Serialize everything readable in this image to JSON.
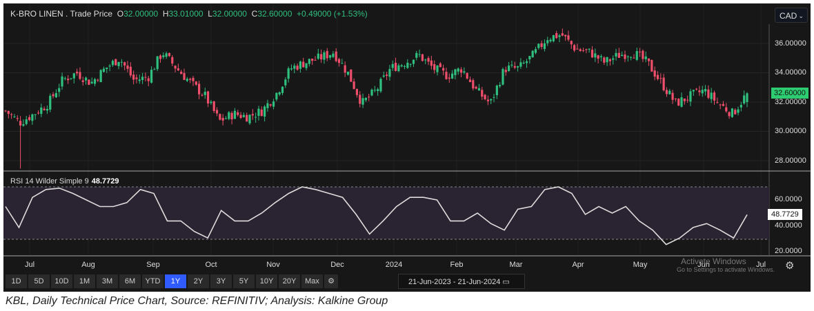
{
  "header": {
    "symbol": "K-BRO LINEN",
    "series": "Trade Price",
    "o_label": "O",
    "open": "32.00000",
    "h_label": "H",
    "high": "33.01000",
    "l_label": "L",
    "low": "32.00000",
    "c_label": "C",
    "close": "32.60000",
    "change": "+0.49000 (+1.53%)"
  },
  "currency": "CAD",
  "price_axis": [
    "36.00000",
    "34.00000",
    "32.00000",
    "30.00000",
    "28.00000"
  ],
  "last_price": "32.60000",
  "rsi": {
    "label": "RSI 14 Wilder Simple 9",
    "value": "48.7729",
    "axis": [
      "60.0000",
      "40.0000",
      "20.0000"
    ]
  },
  "months": [
    "Jul",
    "Aug",
    "Sep",
    "Oct",
    "Nov",
    "Dec",
    "2024",
    "Feb",
    "Mar",
    "Apr",
    "May",
    "Jun",
    "Jul"
  ],
  "ranges": [
    {
      "label": "1D"
    },
    {
      "label": "5D"
    },
    {
      "label": "10D"
    },
    {
      "label": "1M"
    },
    {
      "label": "3M"
    },
    {
      "label": "6M"
    },
    {
      "label": "YTD"
    },
    {
      "label": "1Y",
      "active": true
    },
    {
      "label": "2Y"
    },
    {
      "label": "3Y"
    },
    {
      "label": "5Y"
    },
    {
      "label": "10Y"
    },
    {
      "label": "20Y"
    },
    {
      "label": "Max"
    }
  ],
  "date_range": "21-Jun-2023  -  21-Jun-2024",
  "watermark": {
    "line1": "Activate Windows",
    "line2": "Go to Settings to activate Windows."
  },
  "caption": "KBL, Daily Technical Price Chart, Source: REFINITIV; Analysis: Kalkine Group",
  "colors": {
    "up": "#2fbf7f",
    "down": "#ef4f6b",
    "rsi_band": "#2a2432",
    "active": "#2f5bff"
  },
  "chart_data": {
    "type": "candlestick",
    "ylim": [
      27.5,
      37.2
    ],
    "closes": [
      31.4,
      30.6,
      31.2,
      31.9,
      33.5,
      34.0,
      33.3,
      34.3,
      35.0,
      33.5,
      33.7,
      35.4,
      34.3,
      33.3,
      32.4,
      30.7,
      31.2,
      31.0,
      31.4,
      32.6,
      34.3,
      34.7,
      35.0,
      35.4,
      34.0,
      31.9,
      32.8,
      34.3,
      34.7,
      35.2,
      34.3,
      33.8,
      34.3,
      32.8,
      31.9,
      34.3,
      34.3,
      35.2,
      36.4,
      36.6,
      35.6,
      35.4,
      34.7,
      35.2,
      35.4,
      34.7,
      33.3,
      31.9,
      32.4,
      32.8,
      31.9,
      31.2,
      32.6
    ],
    "rsi": [
      55,
      39,
      62,
      68,
      69,
      65,
      60,
      55,
      55,
      58,
      68,
      65,
      44,
      44,
      36,
      31,
      52,
      44,
      44,
      50,
      58,
      65,
      70,
      68,
      65,
      62,
      49,
      34,
      44,
      55,
      62,
      62,
      60,
      44,
      44,
      50,
      42,
      37,
      53,
      55,
      68,
      70,
      65,
      49,
      55,
      50,
      55,
      44,
      37,
      26,
      31,
      39,
      42,
      37,
      31,
      48.8
    ],
    "rsi_levels": [
      70,
      30
    ]
  }
}
